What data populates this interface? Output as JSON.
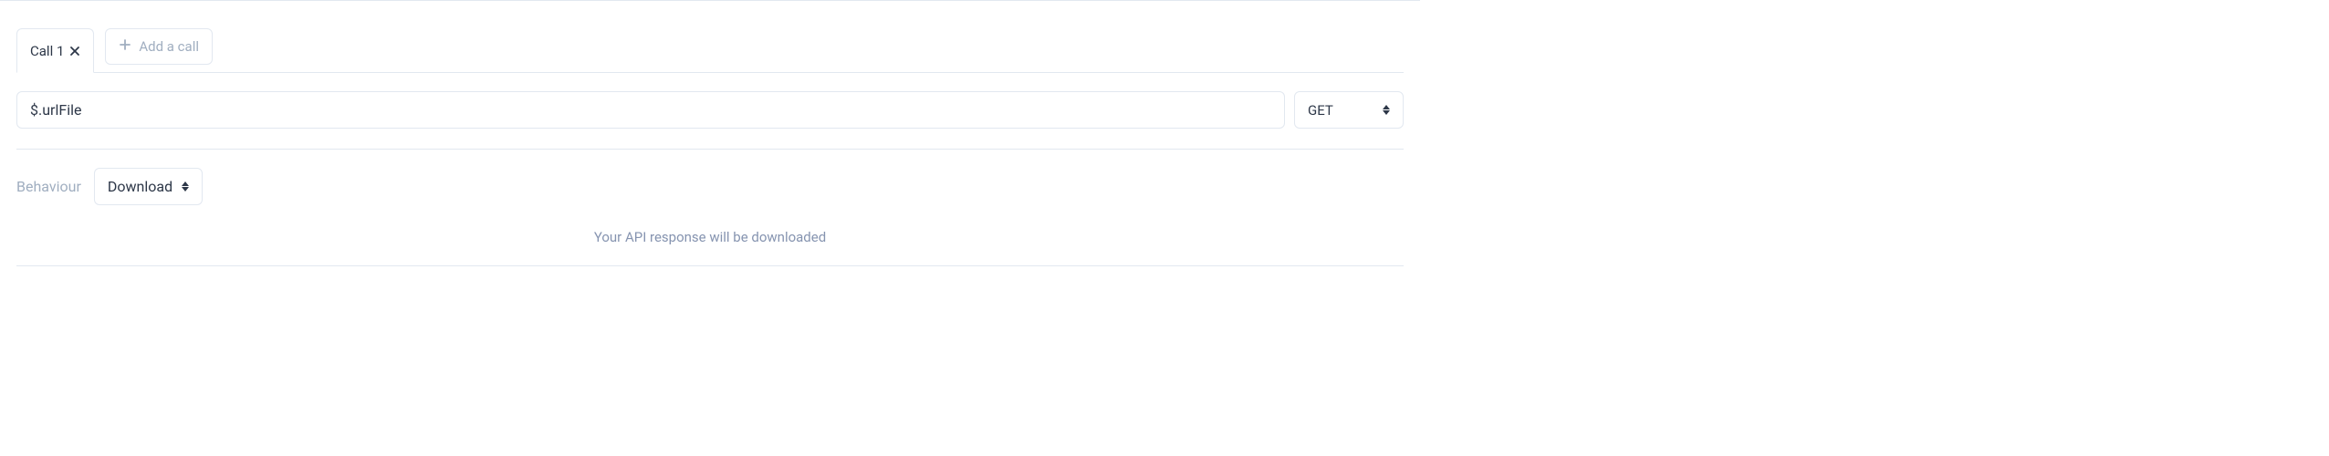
{
  "tabs": {
    "call1_label": "Call 1",
    "add_call_label": "Add a call"
  },
  "url": {
    "value": "$.urlFile"
  },
  "method": {
    "selected": "GET"
  },
  "behaviour": {
    "label": "Behaviour",
    "selected": "Download"
  },
  "info_message": "Your API response will be downloaded"
}
